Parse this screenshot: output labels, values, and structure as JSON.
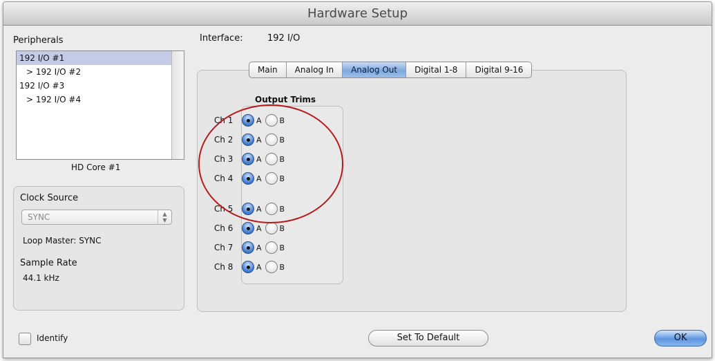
{
  "window": {
    "title": "Hardware Setup"
  },
  "peripherals": {
    "label": "Peripherals",
    "items": [
      {
        "label": "192 I/O #1",
        "selected": true,
        "child": false
      },
      {
        "label": "> 192 I/O #2",
        "selected": false,
        "child": true
      },
      {
        "label": "192 I/O #3",
        "selected": false,
        "child": false
      },
      {
        "label": "> 192 I/O #4",
        "selected": false,
        "child": true
      }
    ],
    "core_label": "HD Core #1"
  },
  "clock": {
    "label": "Clock Source",
    "source_value": "SYNC",
    "loop_master": "Loop Master: SYNC",
    "sample_rate_label": "Sample Rate",
    "sample_rate_value": "44.1 kHz"
  },
  "interface": {
    "label": "Interface:",
    "value": "192 I/O"
  },
  "tabs": [
    {
      "label": "Main",
      "active": false
    },
    {
      "label": "Analog In",
      "active": false
    },
    {
      "label": "Analog Out",
      "active": true
    },
    {
      "label": "Digital 1-8",
      "active": false
    },
    {
      "label": "Digital 9-16",
      "active": false
    }
  ],
  "output_trims": {
    "title": "Output Trims",
    "option_a": "A",
    "option_b": "B",
    "channels": [
      {
        "label": "Ch 1",
        "selected": "A"
      },
      {
        "label": "Ch 2",
        "selected": "A"
      },
      {
        "label": "Ch 3",
        "selected": "A"
      },
      {
        "label": "Ch 4",
        "selected": "A"
      },
      {
        "label": "Ch 5",
        "selected": "A"
      },
      {
        "label": "Ch 6",
        "selected": "A"
      },
      {
        "label": "Ch 7",
        "selected": "A"
      },
      {
        "label": "Ch 8",
        "selected": "A"
      }
    ]
  },
  "footer": {
    "identify_label": "Identify",
    "identify_checked": false,
    "set_default_label": "Set To Default",
    "ok_label": "OK"
  },
  "colors": {
    "selection": "#c5cbe6",
    "active_tab": "#7ea8de",
    "annotation": "#b51b1b"
  }
}
